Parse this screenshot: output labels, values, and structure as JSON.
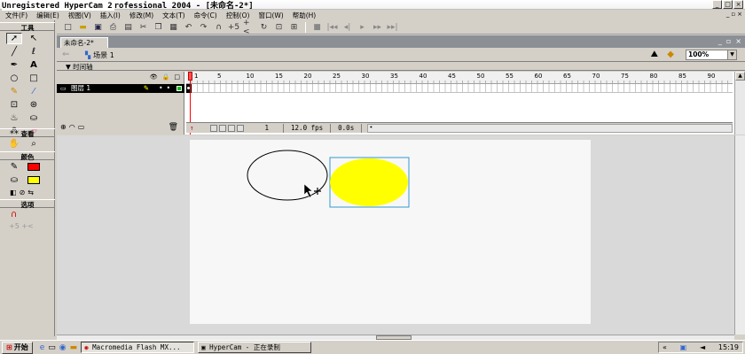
{
  "window": {
    "title_hypercam": "Unregistered HyperCam 2",
    "title_rest": "rofessional 2004 - [未命名-2*]"
  },
  "menu": {
    "items": [
      "文件(F)",
      "编辑(E)",
      "视图(V)",
      "插入(I)",
      "修改(M)",
      "文本(T)",
      "命令(C)",
      "控制(O)",
      "窗口(W)",
      "帮助(H)"
    ]
  },
  "tools_panel": {
    "header_tools": "工具",
    "header_view": "查看",
    "header_colors": "颜色",
    "header_options": "选项",
    "stroke_color": "#ff0000",
    "fill_color": "#ffff00"
  },
  "document": {
    "tab_label": "未命名-2*",
    "scene_label": "场景 1",
    "zoom": "100%"
  },
  "timeline": {
    "header": "▼ 时间轴",
    "layer_name": "图层 1",
    "ruler_ticks": [
      "1",
      "5",
      "10",
      "15",
      "20",
      "25",
      "30",
      "35",
      "40",
      "45",
      "50",
      "55",
      "60",
      "65",
      "70",
      "75",
      "80",
      "85",
      "90"
    ],
    "current_frame": "1",
    "frame_rate": "12.0 fps",
    "elapsed": "0.0s",
    "layer_color": "#00c000"
  },
  "stage": {
    "background": "#f7f7f7",
    "fill_circle_color": "#ffff00",
    "selection_color": "#3399cc"
  },
  "taskbar": {
    "start_label": "开始",
    "tasks": [
      "Macromedia Flash MX...",
      "HyperCam - 正在录制"
    ],
    "clock": "15:19"
  }
}
